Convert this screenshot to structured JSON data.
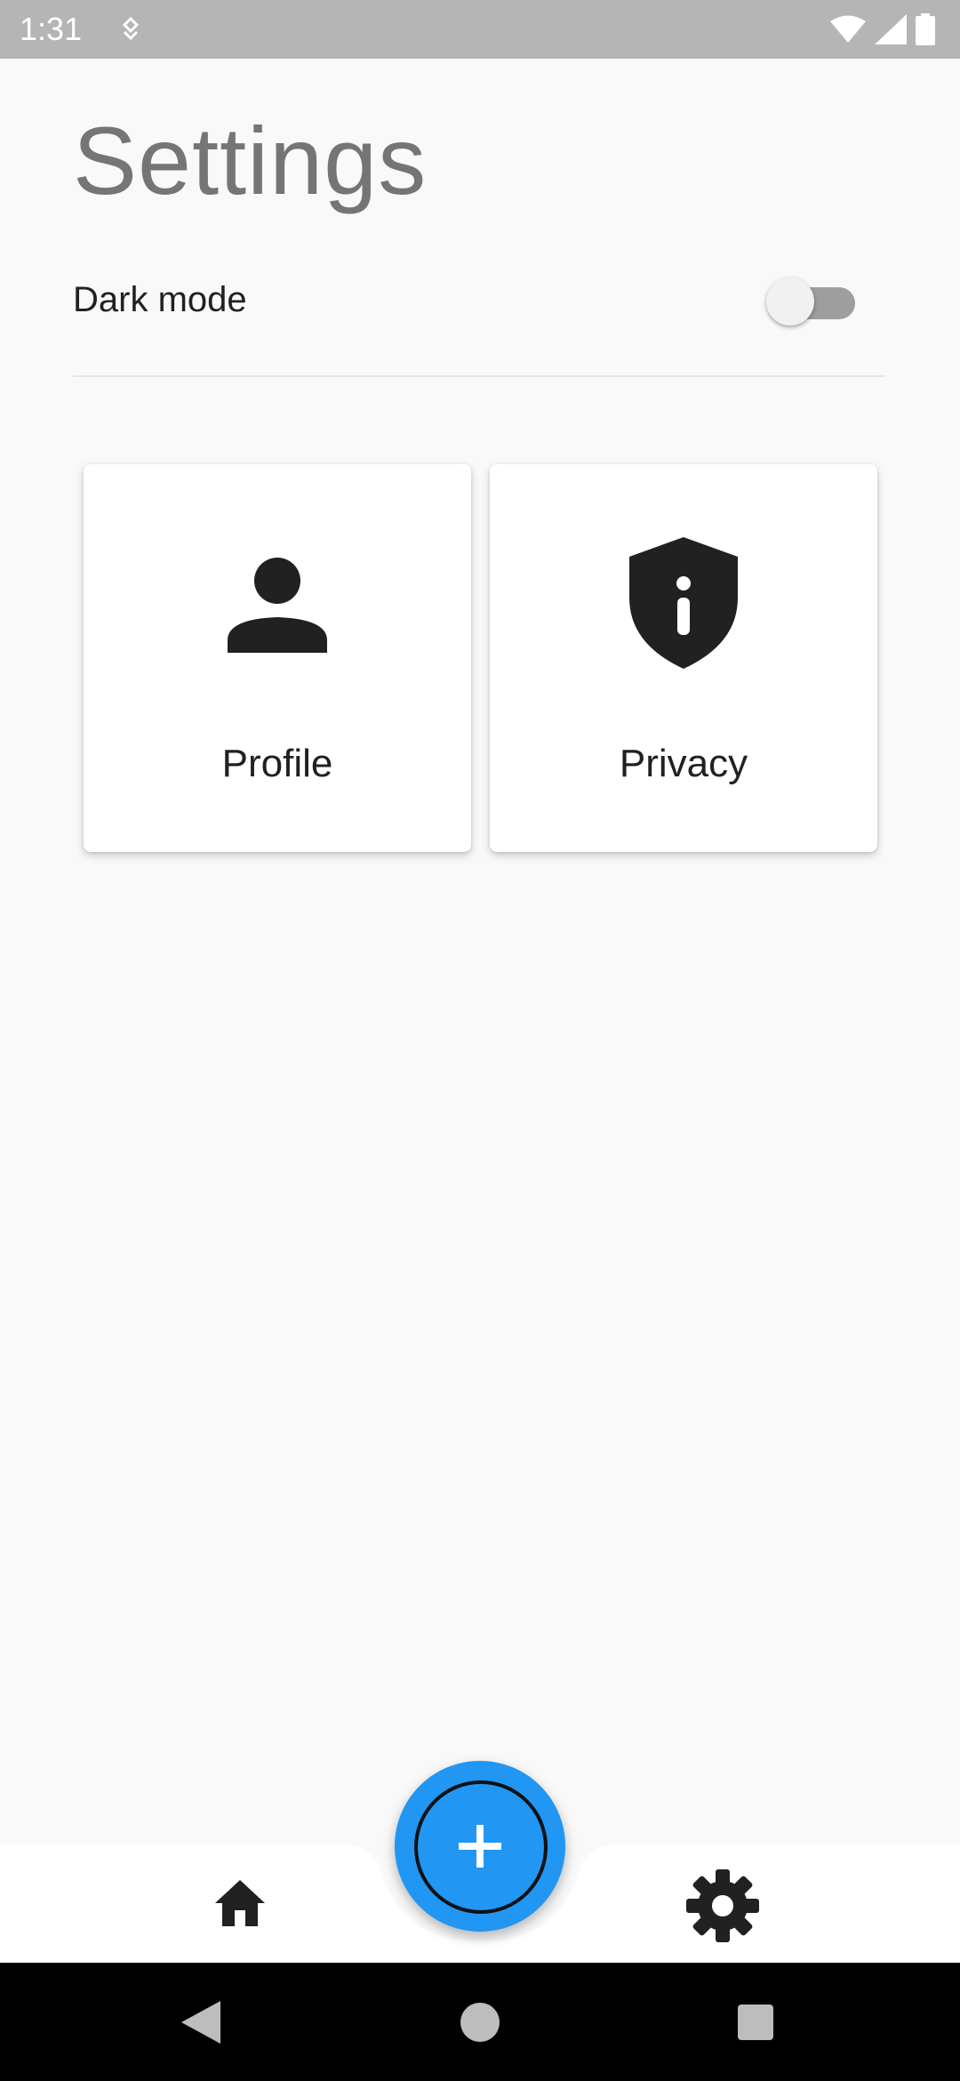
{
  "status_bar": {
    "time": "1:31",
    "icons": [
      "notification-icon",
      "wifi-icon",
      "cell-signal-icon",
      "battery-icon"
    ]
  },
  "page": {
    "title": "Settings"
  },
  "dark_mode": {
    "label": "Dark mode",
    "enabled": false
  },
  "cards": [
    {
      "label": "Profile",
      "icon": "person-icon"
    },
    {
      "label": "Privacy",
      "icon": "shield-info-icon"
    }
  ],
  "bottom_nav": {
    "items": [
      "home-icon",
      "settings-gear-icon"
    ],
    "fab_icon": "plus-icon"
  },
  "system_nav": [
    "back",
    "home",
    "recents"
  ],
  "colors": {
    "accent": "#2196f3",
    "status_bar": "#b5b5b5",
    "background": "#f9f9f9",
    "title": "#757575",
    "text": "#212121"
  }
}
